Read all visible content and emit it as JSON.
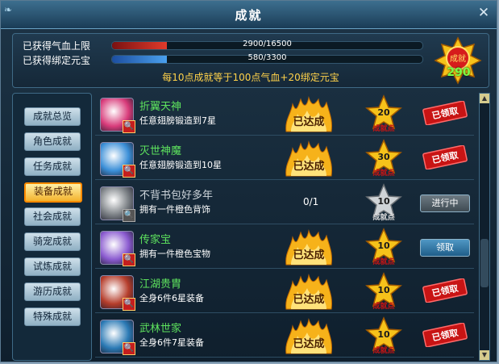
{
  "window": {
    "title": "成就",
    "close_label": "✕"
  },
  "stats": {
    "hp_label": "已获得气血上限",
    "hp_value": "2900/16500",
    "hp_ratio": 0.1758,
    "yb_label": "已获得绑定元宝",
    "yb_value": "580/3300",
    "yb_ratio": 0.1758,
    "note": "每10点成就等于100点气血+20绑定元宝",
    "medal_label": "成就",
    "medal_value": "290"
  },
  "sidebar": {
    "items": [
      {
        "label": "成就总览"
      },
      {
        "label": "角色成就"
      },
      {
        "label": "任务成就"
      },
      {
        "label": "装备成就",
        "active": true
      },
      {
        "label": "社会成就"
      },
      {
        "label": "骑宠成就"
      },
      {
        "label": "试炼成就"
      },
      {
        "label": "游历成就"
      },
      {
        "label": "特殊成就"
      }
    ]
  },
  "achievements": [
    {
      "name": "折翼天神",
      "desc": "任意翅膀锻造到7星",
      "points": "20",
      "state": "claimed",
      "flame": "已达成",
      "stamp": "已领取",
      "star_label": "成就点",
      "icon_color": "#d83b7a"
    },
    {
      "name": "灭世神魔",
      "desc": "任意翅膀锻造到10星",
      "points": "30",
      "state": "claimed",
      "flame": "已达成",
      "stamp": "已领取",
      "star_label": "成就点",
      "icon_color": "#3b8fd8"
    },
    {
      "name": "不背书包好多年",
      "desc": "拥有一件橙色背饰",
      "points": "10",
      "state": "in_progress",
      "progress": "0/1",
      "button": "进行中",
      "star_label": "成就点",
      "icon_color": "#7a7f84"
    },
    {
      "name": "传家宝",
      "desc": "拥有一件橙色宝物",
      "points": "10",
      "state": "claimable",
      "flame": "已达成",
      "button": "领取",
      "star_label": "成就点",
      "icon_color": "#8b5bd0"
    },
    {
      "name": "江湖贵胄",
      "desc": "全身6件6星装备",
      "points": "10",
      "state": "claimed",
      "flame": "已达成",
      "stamp": "已领取",
      "star_label": "成就点",
      "icon_color": "#b53d2b"
    },
    {
      "name": "武林世家",
      "desc": "全身6件7星装备",
      "points": "10",
      "state": "claimed",
      "flame": "已达成",
      "stamp": "已领取",
      "star_label": "成就点",
      "icon_color": "#2b7ab5"
    }
  ],
  "colors": {
    "green": "#5ee35e",
    "gold": "#ffd24a",
    "red_stamp": "#c81414"
  }
}
